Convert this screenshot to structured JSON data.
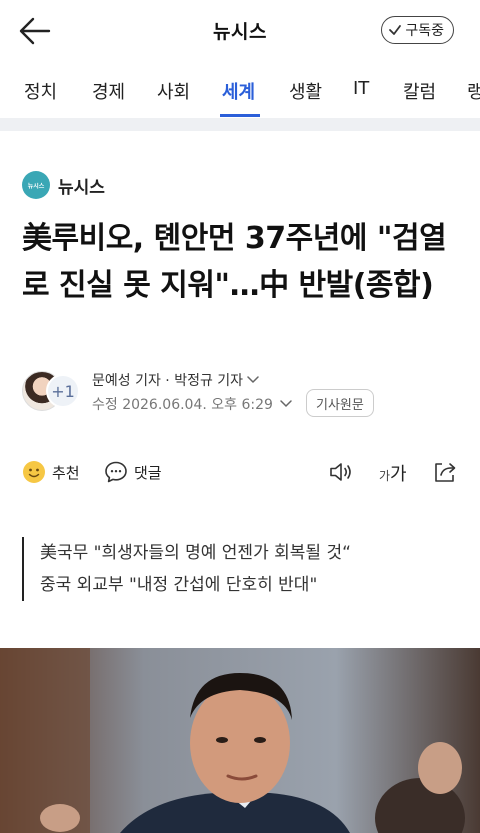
{
  "header": {
    "title": "뉴시스",
    "subscribe_label": "구독중"
  },
  "tabs": [
    {
      "label": "정치"
    },
    {
      "label": "경제"
    },
    {
      "label": "사회"
    },
    {
      "label": "세계"
    },
    {
      "label": "생활"
    },
    {
      "label": "IT"
    },
    {
      "label": "칼럼"
    },
    {
      "label": "랭"
    }
  ],
  "active_tab": "세계",
  "article": {
    "press_logo_text": "뉴시스",
    "press_name": "뉴시스",
    "headline": "美루비오, 톈안먼 37주년에 \"검열로 진실 못 지워\"…中 반발(종합)",
    "extra_reporters": "+1",
    "reporters": "문예성 기자 · 박정규 기자",
    "modified": "수정 2026.06.04. 오후 6:29",
    "original_button": "기사원문",
    "recommend_label": "추천",
    "comment_label": "댓글",
    "font_small": "가",
    "font_large": "가",
    "summary": [
      "美국무 \"희생자들의 명예 언젠가 회복될 것“",
      "중국 외교부 \"내정 간섭에 단호히 반대\""
    ]
  },
  "colors": {
    "accent": "#2b5fd9",
    "press_logo": "#3aa7b5"
  },
  "icons": [
    "back-arrow-icon",
    "check-icon",
    "chevron-down-icon",
    "smile-icon",
    "comment-icon",
    "speaker-icon",
    "share-icon"
  ]
}
